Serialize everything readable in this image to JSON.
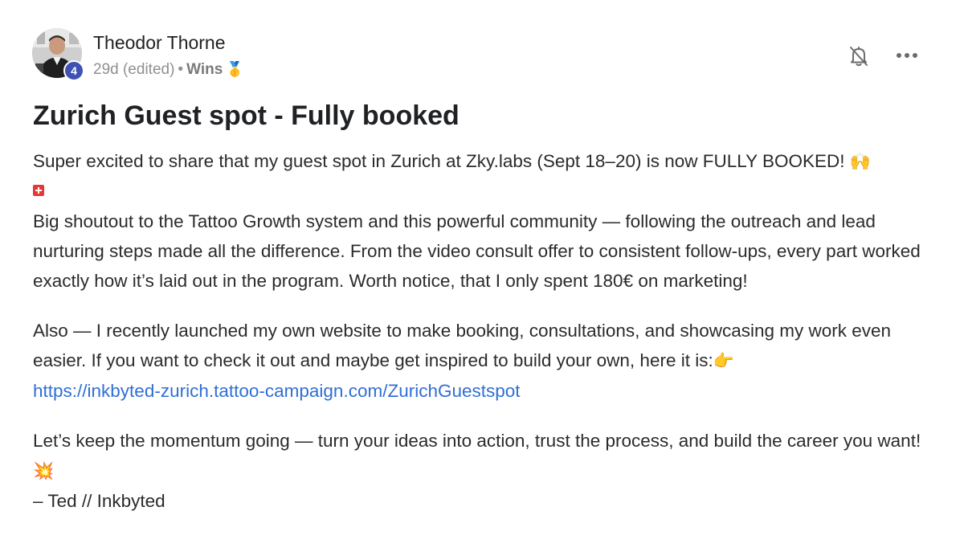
{
  "author": {
    "name": "Theodor Thorne",
    "level": "4",
    "time": "29d (edited)",
    "separator": "•",
    "category": "Wins",
    "category_emoji": "🥇"
  },
  "header_icons": {
    "bell": "bell-slash-icon",
    "more": "more-horizontal-icon"
  },
  "post": {
    "title": "Zurich Guest spot - Fully booked",
    "p1_text": "Super excited to share that my guest spot in Zurich at Zky.labs (Sept 18–20) is now FULLY BOOKED!",
    "p1_emoji": "🙌",
    "p1_flag": "🇨🇭",
    "p2_text": "Big shoutout to the Tattoo Growth system and this powerful community — following the outreach and lead nurturing steps made all the difference. From the video consult offer to consistent follow-ups, every part worked exactly how it’s laid out in the program. Worth notice, that I only spent 180€ on marketing!",
    "p3_text": "Also — I recently launched my own website to make booking, consultations, and showcasing my work even easier. If you want to check it out and maybe get inspired to build your own, here it is:",
    "p3_emoji": "👉",
    "link": "https://inkbyted-zurich.tattoo-campaign.com/ZurichGuestspot",
    "p4_text": "Let’s keep the momentum going — turn your ideas into action, trust the process, and build the career you want!",
    "p4_emoji": "💥",
    "signature": "– Ted // Inkbyted"
  },
  "colors": {
    "link": "#2f6fd6",
    "level_badge": "#3f51b5",
    "meta_text": "#909090"
  }
}
